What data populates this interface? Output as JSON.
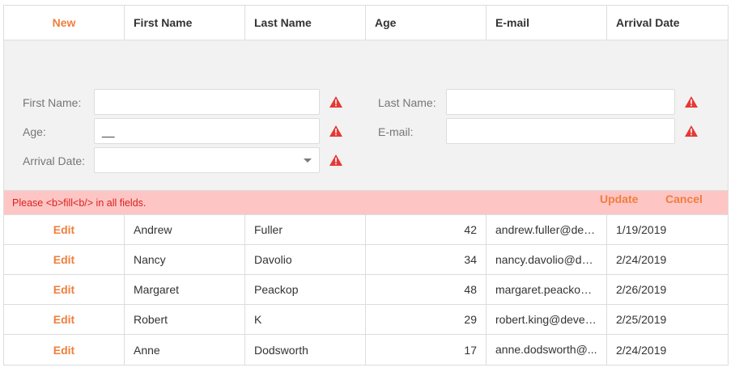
{
  "grid": {
    "new_label": "New",
    "columns": [
      "First Name",
      "Last Name",
      "Age",
      "E-mail",
      "Arrival Date"
    ]
  },
  "form": {
    "first_name_label": "First Name:",
    "first_name_value": "",
    "last_name_label": "Last Name:",
    "last_name_value": "",
    "age_label": "Age:",
    "age_value": "__",
    "email_label": "E-mail:",
    "email_value": "",
    "arrival_label": "Arrival Date:",
    "arrival_value": "",
    "update_label": "Update",
    "cancel_label": "Cancel"
  },
  "error": {
    "message": "Please <b>fill<b/> in all fields."
  },
  "rows": [
    {
      "action": "Edit",
      "first": "Andrew",
      "last": "Fuller",
      "age": "42",
      "email": "andrew.fuller@dev...",
      "date": "1/19/2019"
    },
    {
      "action": "Edit",
      "first": "Nancy",
      "last": "Davolio",
      "age": "34",
      "email": "nancy.davolio@de...",
      "date": "2/24/2019"
    },
    {
      "action": "Edit",
      "first": "Margaret",
      "last": "Peackop",
      "age": "48",
      "email": "margaret.peackop....",
      "date": "2/26/2019"
    },
    {
      "action": "Edit",
      "first": "Robert",
      "last": "K",
      "age": "29",
      "email": "robert.king@devex...",
      "date": "2/25/2019"
    },
    {
      "action": "Edit",
      "first": "Anne",
      "last": "Dodsworth",
      "age": "17",
      "email": "anne.dodsworth@...",
      "date": "2/24/2019"
    }
  ],
  "colors": {
    "accent": "#f07e3c",
    "error_bg": "#fec5c5",
    "error_text": "#d9221b",
    "warning": "#e53935"
  },
  "icons": {
    "validation": "warning-triangle-icon",
    "dropdown": "chevron-down-icon"
  }
}
